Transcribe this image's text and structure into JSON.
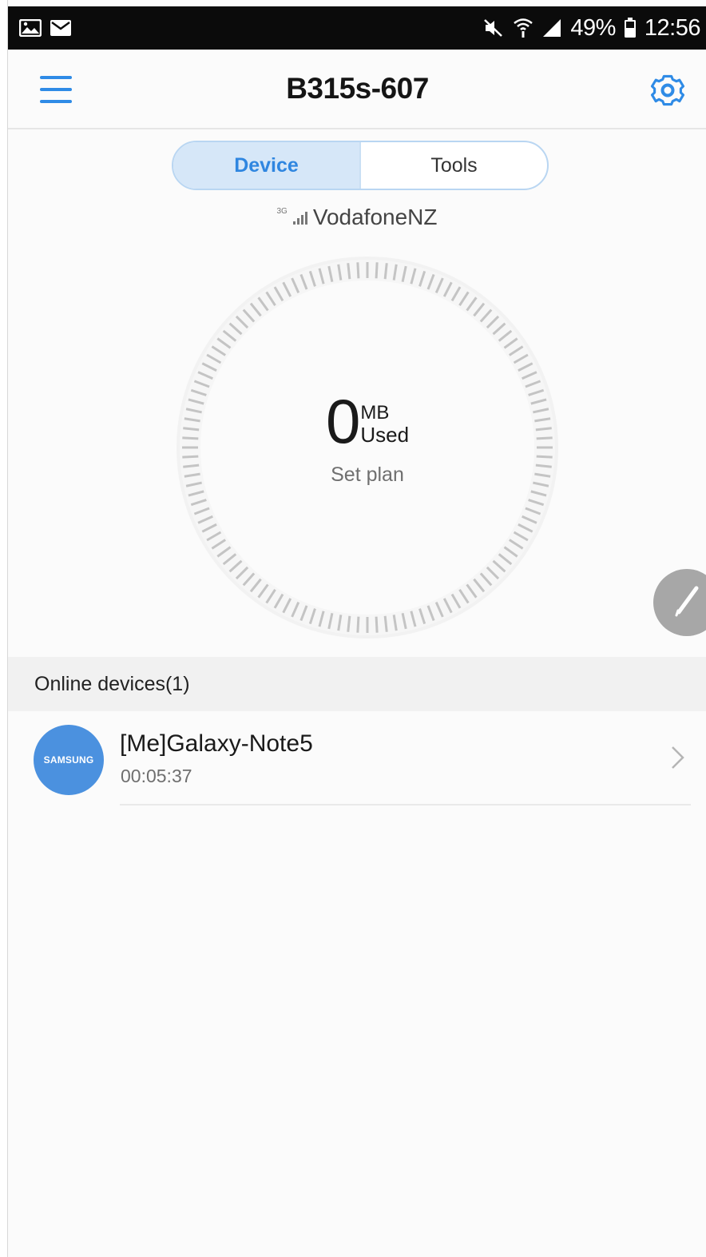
{
  "status_bar": {
    "left_icons": [
      "gallery-icon",
      "email-icon"
    ],
    "right_icons": [
      "mute-icon",
      "wifi-icon",
      "signal-icon"
    ],
    "battery": "49%",
    "time": "12:56"
  },
  "app_bar": {
    "title": "B315s-607",
    "menu_icon": "hamburger-menu-icon",
    "settings_icon": "gear-icon",
    "accent_color": "#2f8be6"
  },
  "tabs": [
    {
      "label": "Device",
      "active": true
    },
    {
      "label": "Tools",
      "active": false
    }
  ],
  "network": {
    "tech": "3G",
    "name": "VodafoneNZ"
  },
  "usage": {
    "value": "0",
    "unit": "MB",
    "label": "Used",
    "action": "Set plan"
  },
  "edit_fab": {
    "icon": "pencil-icon"
  },
  "online_devices": {
    "title": "Online devices(1)",
    "devices": [
      {
        "brand": "SAMSUNG",
        "name": "[Me]Galaxy-Note5",
        "duration": "00:05:37",
        "avatar_color": "#4b91df"
      }
    ]
  }
}
